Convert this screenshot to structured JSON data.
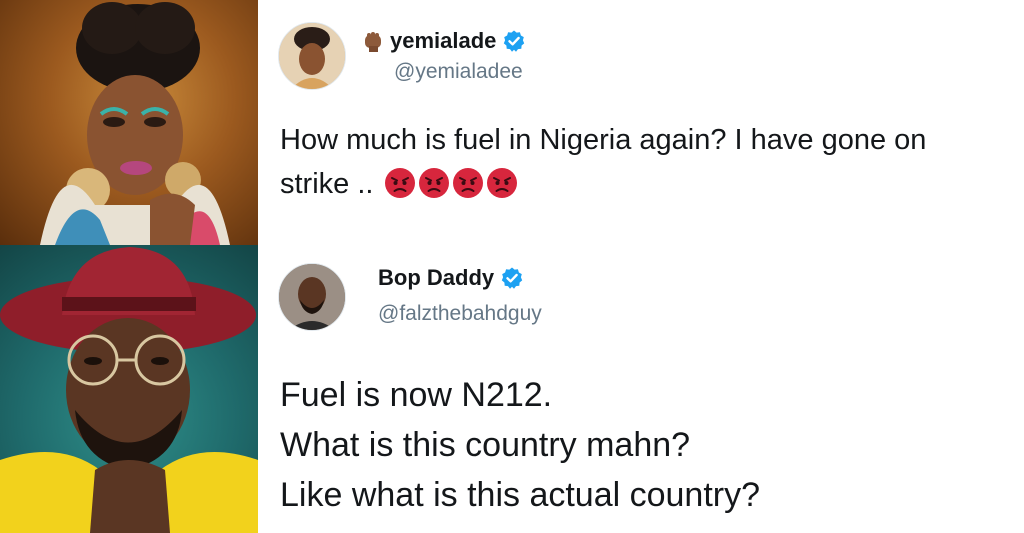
{
  "tweets": [
    {
      "display_name": "yemialade",
      "handle": "@yemialadee",
      "name_emoji": "raised-fist-emoji",
      "verified": true,
      "lines": [
        "How much is fuel in Nigeria again? I have gone on",
        "strike .."
      ],
      "trailing_emoji": [
        "angry-face-emoji",
        "angry-face-emoji",
        "angry-face-emoji",
        "angry-face-emoji"
      ]
    },
    {
      "display_name": "Bop Daddy",
      "handle": "@falzthebahdguy",
      "verified": true,
      "lines": [
        "Fuel is now N212.",
        "What is this country mahn?",
        "Like what is this actual country?"
      ]
    }
  ],
  "colors": {
    "verified_blue": "#1da1f2",
    "text": "#14171a",
    "handle_grey": "#657786",
    "angry_red": "#d7263d"
  }
}
